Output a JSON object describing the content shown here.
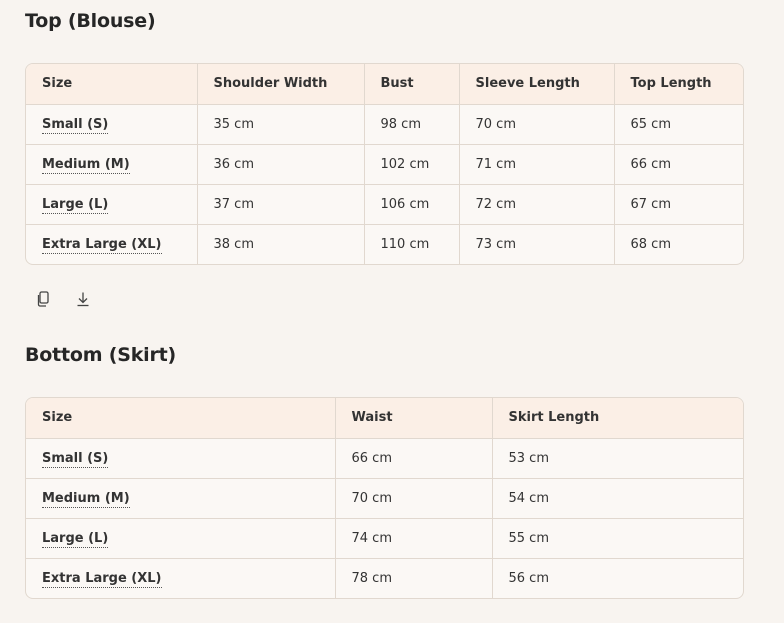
{
  "top": {
    "title": "Top (Blouse)",
    "headers": [
      "Size",
      "Shoulder Width",
      "Bust",
      "Sleeve Length",
      "Top Length"
    ],
    "rows": [
      [
        "Small (S)",
        "35 cm",
        "98 cm",
        "70 cm",
        "65 cm"
      ],
      [
        "Medium (M)",
        "36 cm",
        "102 cm",
        "71 cm",
        "66 cm"
      ],
      [
        "Large (L)",
        "37 cm",
        "106 cm",
        "72 cm",
        "67 cm"
      ],
      [
        "Extra Large (XL)",
        "38 cm",
        "110 cm",
        "73 cm",
        "68 cm"
      ]
    ]
  },
  "actions": {
    "copy_icon": "copy-icon",
    "download_icon": "download-icon"
  },
  "bottom": {
    "title": "Bottom (Skirt)",
    "headers": [
      "Size",
      "Waist",
      "Skirt Length"
    ],
    "rows": [
      [
        "Small (S)",
        "66 cm",
        "53 cm"
      ],
      [
        "Medium (M)",
        "70 cm",
        "54 cm"
      ],
      [
        "Large (L)",
        "74 cm",
        "55 cm"
      ],
      [
        "Extra Large (XL)",
        "78 cm",
        "56 cm"
      ]
    ]
  }
}
